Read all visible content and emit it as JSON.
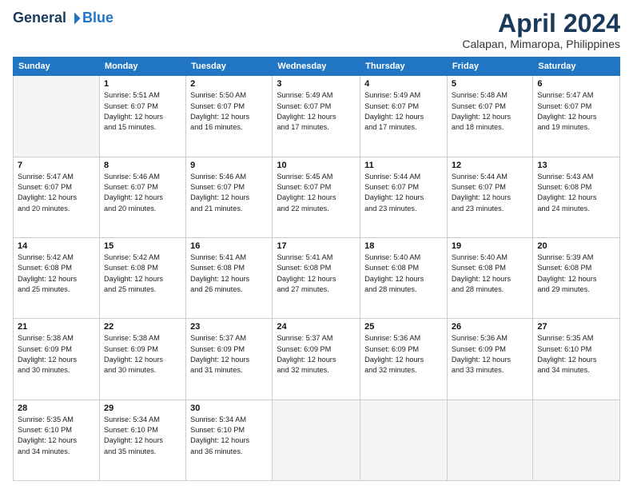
{
  "header": {
    "logo_general": "General",
    "logo_blue": "Blue",
    "month": "April 2024",
    "location": "Calapan, Mimaropa, Philippines"
  },
  "columns": [
    "Sunday",
    "Monday",
    "Tuesday",
    "Wednesday",
    "Thursday",
    "Friday",
    "Saturday"
  ],
  "weeks": [
    [
      {
        "day": "",
        "info": ""
      },
      {
        "day": "1",
        "info": "Sunrise: 5:51 AM\nSunset: 6:07 PM\nDaylight: 12 hours\nand 15 minutes."
      },
      {
        "day": "2",
        "info": "Sunrise: 5:50 AM\nSunset: 6:07 PM\nDaylight: 12 hours\nand 16 minutes."
      },
      {
        "day": "3",
        "info": "Sunrise: 5:49 AM\nSunset: 6:07 PM\nDaylight: 12 hours\nand 17 minutes."
      },
      {
        "day": "4",
        "info": "Sunrise: 5:49 AM\nSunset: 6:07 PM\nDaylight: 12 hours\nand 17 minutes."
      },
      {
        "day": "5",
        "info": "Sunrise: 5:48 AM\nSunset: 6:07 PM\nDaylight: 12 hours\nand 18 minutes."
      },
      {
        "day": "6",
        "info": "Sunrise: 5:47 AM\nSunset: 6:07 PM\nDaylight: 12 hours\nand 19 minutes."
      }
    ],
    [
      {
        "day": "7",
        "info": "Sunrise: 5:47 AM\nSunset: 6:07 PM\nDaylight: 12 hours\nand 20 minutes."
      },
      {
        "day": "8",
        "info": "Sunrise: 5:46 AM\nSunset: 6:07 PM\nDaylight: 12 hours\nand 20 minutes."
      },
      {
        "day": "9",
        "info": "Sunrise: 5:46 AM\nSunset: 6:07 PM\nDaylight: 12 hours\nand 21 minutes."
      },
      {
        "day": "10",
        "info": "Sunrise: 5:45 AM\nSunset: 6:07 PM\nDaylight: 12 hours\nand 22 minutes."
      },
      {
        "day": "11",
        "info": "Sunrise: 5:44 AM\nSunset: 6:07 PM\nDaylight: 12 hours\nand 23 minutes."
      },
      {
        "day": "12",
        "info": "Sunrise: 5:44 AM\nSunset: 6:07 PM\nDaylight: 12 hours\nand 23 minutes."
      },
      {
        "day": "13",
        "info": "Sunrise: 5:43 AM\nSunset: 6:08 PM\nDaylight: 12 hours\nand 24 minutes."
      }
    ],
    [
      {
        "day": "14",
        "info": "Sunrise: 5:42 AM\nSunset: 6:08 PM\nDaylight: 12 hours\nand 25 minutes."
      },
      {
        "day": "15",
        "info": "Sunrise: 5:42 AM\nSunset: 6:08 PM\nDaylight: 12 hours\nand 25 minutes."
      },
      {
        "day": "16",
        "info": "Sunrise: 5:41 AM\nSunset: 6:08 PM\nDaylight: 12 hours\nand 26 minutes."
      },
      {
        "day": "17",
        "info": "Sunrise: 5:41 AM\nSunset: 6:08 PM\nDaylight: 12 hours\nand 27 minutes."
      },
      {
        "day": "18",
        "info": "Sunrise: 5:40 AM\nSunset: 6:08 PM\nDaylight: 12 hours\nand 28 minutes."
      },
      {
        "day": "19",
        "info": "Sunrise: 5:40 AM\nSunset: 6:08 PM\nDaylight: 12 hours\nand 28 minutes."
      },
      {
        "day": "20",
        "info": "Sunrise: 5:39 AM\nSunset: 6:08 PM\nDaylight: 12 hours\nand 29 minutes."
      }
    ],
    [
      {
        "day": "21",
        "info": "Sunrise: 5:38 AM\nSunset: 6:09 PM\nDaylight: 12 hours\nand 30 minutes."
      },
      {
        "day": "22",
        "info": "Sunrise: 5:38 AM\nSunset: 6:09 PM\nDaylight: 12 hours\nand 30 minutes."
      },
      {
        "day": "23",
        "info": "Sunrise: 5:37 AM\nSunset: 6:09 PM\nDaylight: 12 hours\nand 31 minutes."
      },
      {
        "day": "24",
        "info": "Sunrise: 5:37 AM\nSunset: 6:09 PM\nDaylight: 12 hours\nand 32 minutes."
      },
      {
        "day": "25",
        "info": "Sunrise: 5:36 AM\nSunset: 6:09 PM\nDaylight: 12 hours\nand 32 minutes."
      },
      {
        "day": "26",
        "info": "Sunrise: 5:36 AM\nSunset: 6:09 PM\nDaylight: 12 hours\nand 33 minutes."
      },
      {
        "day": "27",
        "info": "Sunrise: 5:35 AM\nSunset: 6:10 PM\nDaylight: 12 hours\nand 34 minutes."
      }
    ],
    [
      {
        "day": "28",
        "info": "Sunrise: 5:35 AM\nSunset: 6:10 PM\nDaylight: 12 hours\nand 34 minutes."
      },
      {
        "day": "29",
        "info": "Sunrise: 5:34 AM\nSunset: 6:10 PM\nDaylight: 12 hours\nand 35 minutes."
      },
      {
        "day": "30",
        "info": "Sunrise: 5:34 AM\nSunset: 6:10 PM\nDaylight: 12 hours\nand 36 minutes."
      },
      {
        "day": "",
        "info": ""
      },
      {
        "day": "",
        "info": ""
      },
      {
        "day": "",
        "info": ""
      },
      {
        "day": "",
        "info": ""
      }
    ]
  ]
}
